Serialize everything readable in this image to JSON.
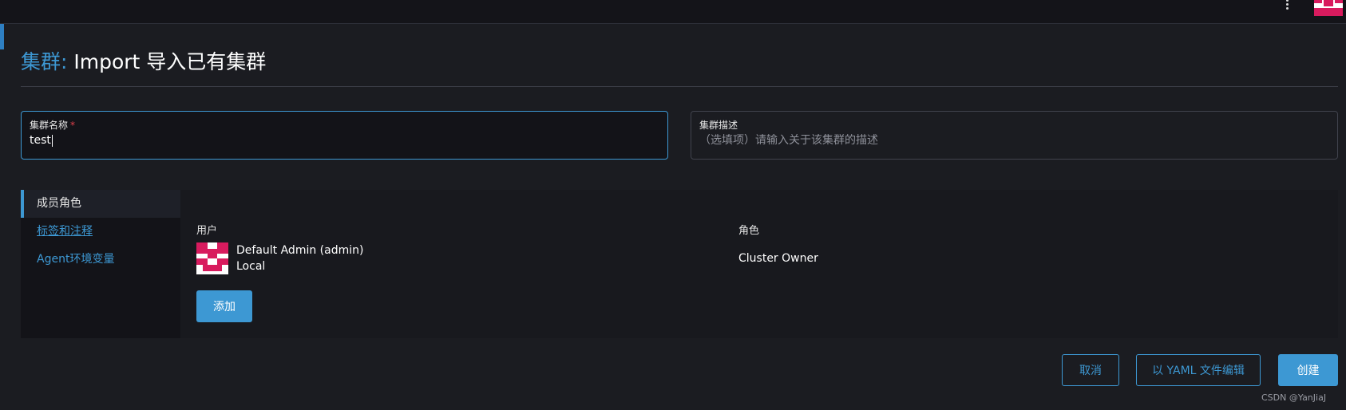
{
  "header": {
    "menu_icon": "kebab-menu-icon",
    "avatar_icon": "user-avatar-icon"
  },
  "page": {
    "breadcrumb": "集群:",
    "title": "Import 导入已有集群"
  },
  "form": {
    "name": {
      "label": "集群名称",
      "required_mark": "*",
      "value": "test"
    },
    "description": {
      "label": "集群描述",
      "placeholder": "（选填项）请输入关于该集群的描述",
      "value": ""
    }
  },
  "tabs": [
    {
      "label": "成员角色",
      "active": true
    },
    {
      "label": "标签和注释",
      "active": false
    },
    {
      "label": "Agent环境变量",
      "active": false
    }
  ],
  "members": {
    "col_user": "用户",
    "col_role": "角色",
    "rows": [
      {
        "name": "Default Admin (admin)",
        "provider": "Local",
        "role": "Cluster Owner"
      }
    ],
    "add_label": "添加"
  },
  "actions": {
    "cancel": "取消",
    "yaml": "以 YAML 文件编辑",
    "create": "创建"
  },
  "watermark": "CSDN @YanJiaJ",
  "colors": {
    "accent": "#3d98d3",
    "background": "#1b1c21",
    "avatar_pink": "#d81b5e",
    "required": "#e0404b"
  }
}
